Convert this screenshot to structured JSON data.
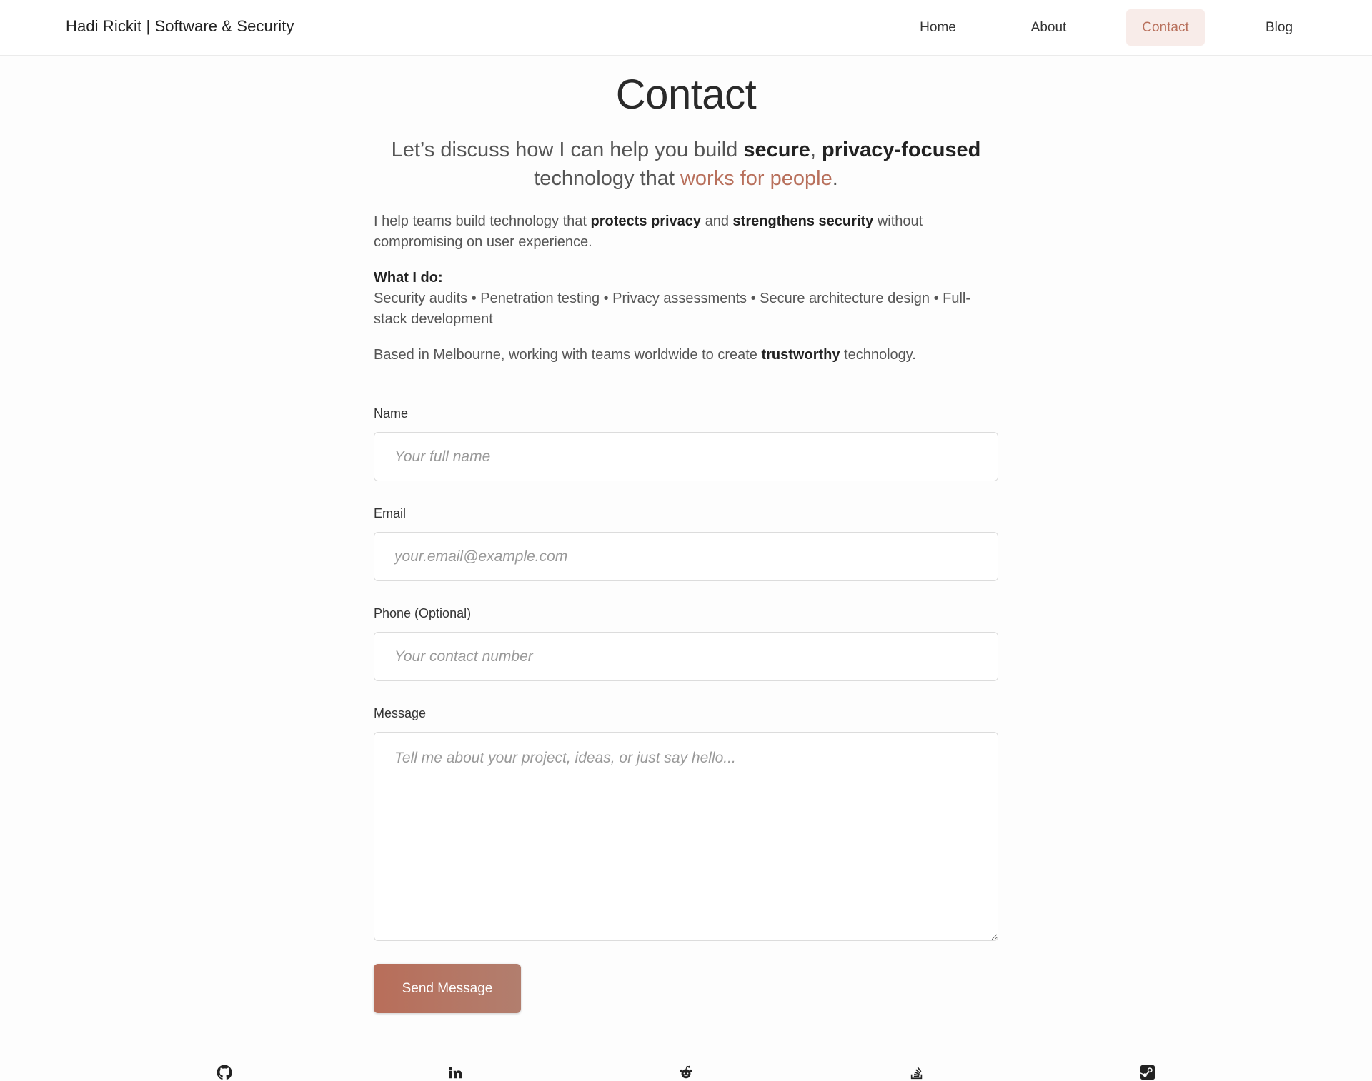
{
  "brand": "Hadi Rickit | Software & Security",
  "nav": {
    "home": "Home",
    "about": "About",
    "contact": "Contact",
    "blog": "Blog",
    "active": "Contact"
  },
  "page": {
    "title": "Contact",
    "lead": {
      "part1": "Let’s discuss how I can help you build ",
      "secure": "secure",
      "comma": ", ",
      "privacy": "privacy-focused",
      "part2": " technology that ",
      "people": "works for people",
      "end": "."
    },
    "intro": {
      "part1": "I help teams build technology that ",
      "protects": "protects privacy",
      "and": " and ",
      "strengthens": "strengthens security",
      "part2": " without compromising on user experience."
    },
    "what_title": "What I do:",
    "what_list": "Security audits • Penetration testing • Privacy assessments • Secure architecture design • Full-stack development",
    "based": {
      "part1": "Based in Melbourne, working with teams worldwide to create ",
      "trustworthy": "trustworthy",
      "part2": " technology."
    }
  },
  "form": {
    "name_label": "Name",
    "name_placeholder": "Your full name",
    "email_label": "Email",
    "email_placeholder": "your.email@example.com",
    "phone_label": "Phone (Optional)",
    "phone_placeholder": "Your contact number",
    "message_label": "Message",
    "message_placeholder": "Tell me about your project, ideas, or just say hello...",
    "submit": "Send Message"
  },
  "socials": [
    "github-icon",
    "linkedin-icon",
    "reddit-icon",
    "stack-overflow-icon",
    "steam-icon"
  ],
  "colors": {
    "accent": "#b8705c",
    "active_nav_bg": "#f8ece9",
    "button": "#b47462"
  }
}
